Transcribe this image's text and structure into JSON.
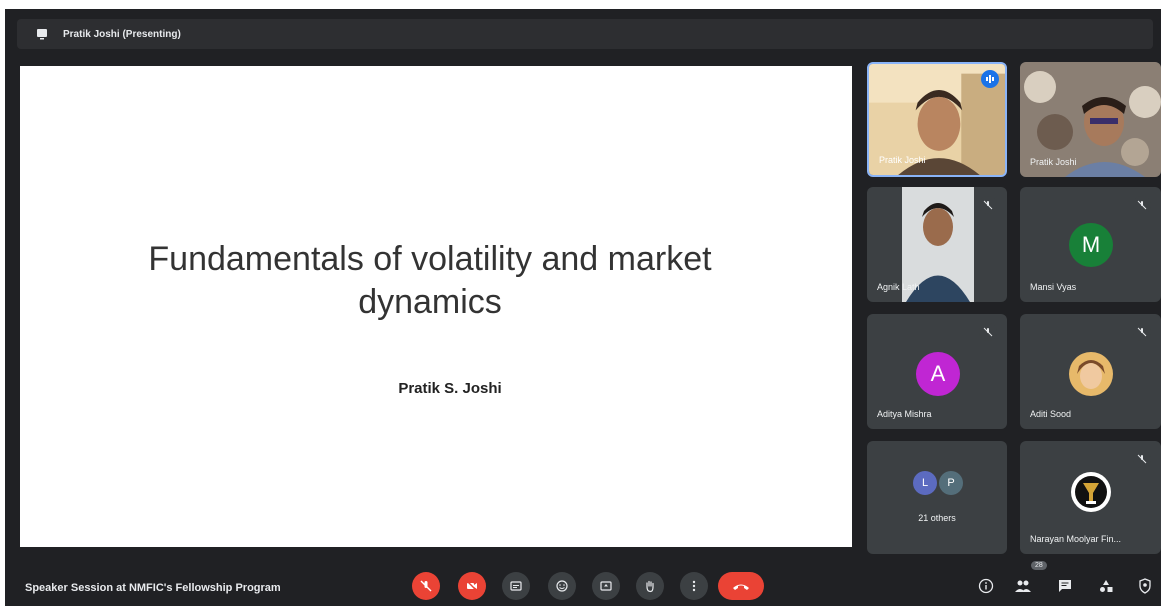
{
  "presenting_bar": {
    "label": "Pratik Joshi (Presenting)"
  },
  "slide": {
    "title_line1": "Fundamentals of volatility and market",
    "title_line2": "dynamics",
    "author": "Pratik S. Joshi"
  },
  "participants": [
    {
      "name": "Pratik Joshi",
      "type": "video"
    },
    {
      "name": "Pratik Joshi",
      "type": "video"
    },
    {
      "name": "Agnik Lath",
      "type": "video",
      "muted": true
    },
    {
      "name": "Mansi Vyas",
      "type": "avatar",
      "initial": "M",
      "color": "#188038",
      "muted": true
    },
    {
      "name": "Aditya Mishra",
      "type": "avatar",
      "initial": "A",
      "color": "#c026d3",
      "muted": true
    },
    {
      "name": "Aditi Sood",
      "type": "photo",
      "muted": true
    },
    {
      "name": "Narayan Moolyar Fin...",
      "type": "logo",
      "muted": true
    }
  ],
  "others": {
    "label": "21 others",
    "initials": [
      "L",
      "P"
    ]
  },
  "meeting": {
    "title": "Speaker Session at NMFIC's Fellowship Program"
  },
  "controls": {
    "people_count": "28",
    "icons": [
      "mic-off-icon",
      "camera-off-icon",
      "captions-icon",
      "emoji-icon",
      "present-icon",
      "raise-hand-icon",
      "more-options-icon",
      "end-call-icon",
      "info-icon",
      "people-icon",
      "chat-icon",
      "activities-icon",
      "host-controls-icon"
    ]
  },
  "colors": {
    "background": "#202124",
    "tile": "#3c4043",
    "danger": "#ea4335",
    "speaking": "#1a73e8"
  }
}
